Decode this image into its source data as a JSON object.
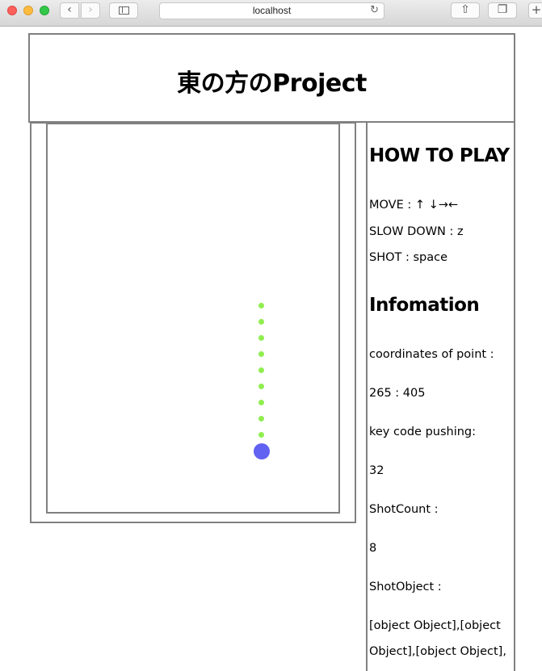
{
  "browser": {
    "url": "localhost",
    "back_icon": "‹",
    "forward_icon": "›",
    "reload_icon": "↻",
    "share_icon": "⇧",
    "tabs_icon": "❐",
    "new_tab_icon": "+"
  },
  "header": {
    "title": "東の方のProject"
  },
  "game": {
    "bullet_color": "#90ee50",
    "player_color": "#6161f2"
  },
  "info": {
    "how_to_play_title": "HOW TO PLAY",
    "controls": [
      "MOVE : ↑ ↓→←",
      "SLOW DOWN : z",
      "SHOT : space"
    ],
    "information_title": "Infomation",
    "coordinates_label": "coordinates of point :",
    "coordinates_value": "265 : 405",
    "keycode_label": "key code pushing:",
    "keycode_value": "32",
    "shotcount_label": "ShotCount :",
    "shotcount_value": "8",
    "shotobject_label": "ShotObject :",
    "shotobject_value_line1": "[object Object],[object",
    "shotobject_value_line2": "Object],[object Object],"
  }
}
